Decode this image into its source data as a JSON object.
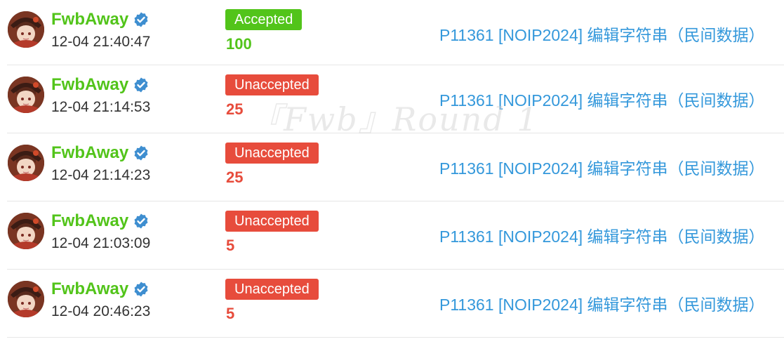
{
  "watermark": "『Fwb』Round 1",
  "colors": {
    "accepted": "#52c41a",
    "unaccepted": "#e74c3c",
    "link": "#3498db",
    "username": "#52c41a"
  },
  "icons": {
    "verified": "verified-check-icon",
    "avatar": "avatar"
  },
  "records": [
    {
      "user": "FwbAway",
      "time": "12-04 21:40:47",
      "status": "Accepted",
      "status_type": "ac",
      "score": "100",
      "problem": "P11361 [NOIP2024] 编辑字符串（民间数据）"
    },
    {
      "user": "FwbAway",
      "time": "12-04 21:14:53",
      "status": "Unaccepted",
      "status_type": "un",
      "score": "25",
      "problem": "P11361 [NOIP2024] 编辑字符串（民间数据）"
    },
    {
      "user": "FwbAway",
      "time": "12-04 21:14:23",
      "status": "Unaccepted",
      "status_type": "un",
      "score": "25",
      "problem": "P11361 [NOIP2024] 编辑字符串（民间数据）"
    },
    {
      "user": "FwbAway",
      "time": "12-04 21:03:09",
      "status": "Unaccepted",
      "status_type": "un",
      "score": "5",
      "problem": "P11361 [NOIP2024] 编辑字符串（民间数据）"
    },
    {
      "user": "FwbAway",
      "time": "12-04 20:46:23",
      "status": "Unaccepted",
      "status_type": "un",
      "score": "5",
      "problem": "P11361 [NOIP2024] 编辑字符串（民间数据）"
    }
  ]
}
